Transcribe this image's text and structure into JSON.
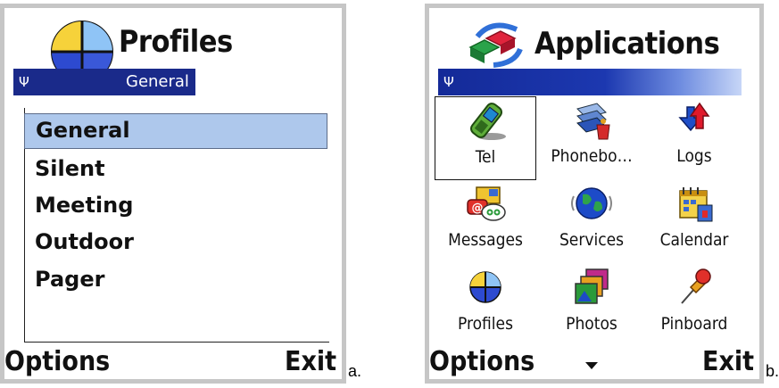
{
  "screen_a": {
    "title": "Profiles",
    "status_text": "General",
    "items": [
      {
        "label": "General",
        "selected": true
      },
      {
        "label": "Silent",
        "selected": false
      },
      {
        "label": "Meeting",
        "selected": false
      },
      {
        "label": "Outdoor",
        "selected": false
      },
      {
        "label": "Pager",
        "selected": false
      }
    ],
    "left_softkey": "Options",
    "right_softkey": "Exit",
    "caption": "a."
  },
  "screen_b": {
    "title": "Applications",
    "apps": [
      {
        "label": "Tel",
        "icon": "phone-icon",
        "focused": true
      },
      {
        "label": "Phonebo…",
        "icon": "phonebook-icon",
        "focused": false
      },
      {
        "label": "Logs",
        "icon": "logs-icon",
        "focused": false
      },
      {
        "label": "Messages",
        "icon": "messages-icon",
        "focused": false
      },
      {
        "label": "Services",
        "icon": "globe-icon",
        "focused": false
      },
      {
        "label": "Calendar",
        "icon": "calendar-icon",
        "focused": false
      },
      {
        "label": "Profiles",
        "icon": "profiles-icon",
        "focused": false
      },
      {
        "label": "Photos",
        "icon": "photos-icon",
        "focused": false
      },
      {
        "label": "Pinboard",
        "icon": "pin-icon",
        "focused": false
      }
    ],
    "left_softkey": "Options",
    "right_softkey": "Exit",
    "caption": "b."
  },
  "colors": {
    "status_bar": "#1a2a8a",
    "selection": "#aec8ec",
    "frame": "#c6c6c6"
  }
}
